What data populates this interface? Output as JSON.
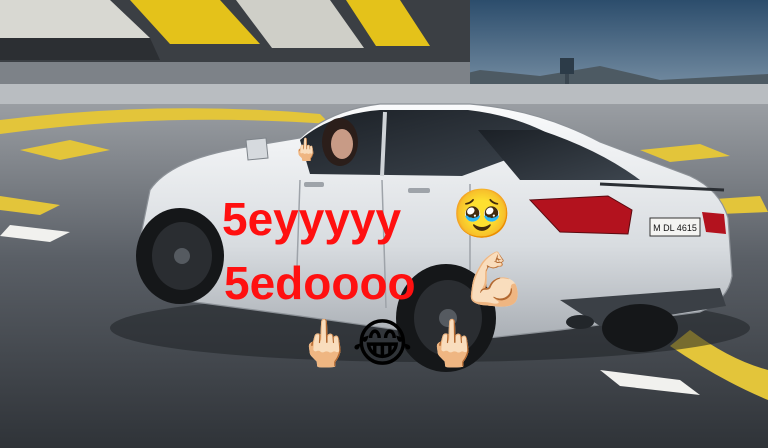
{
  "meme": {
    "caption_line_1": "5eyyyyy",
    "caption_line_2": "5edoooo",
    "caption_color": "#ff1010"
  },
  "car": {
    "plate": "M DL 4615",
    "body_color": "#e9ebee"
  },
  "stickers": [
    "pleading-face-emoji",
    "flexed-biceps-emoji",
    "middle-finger-emoji",
    "tears-of-joy-emoji",
    "middle-finger-emoji"
  ]
}
